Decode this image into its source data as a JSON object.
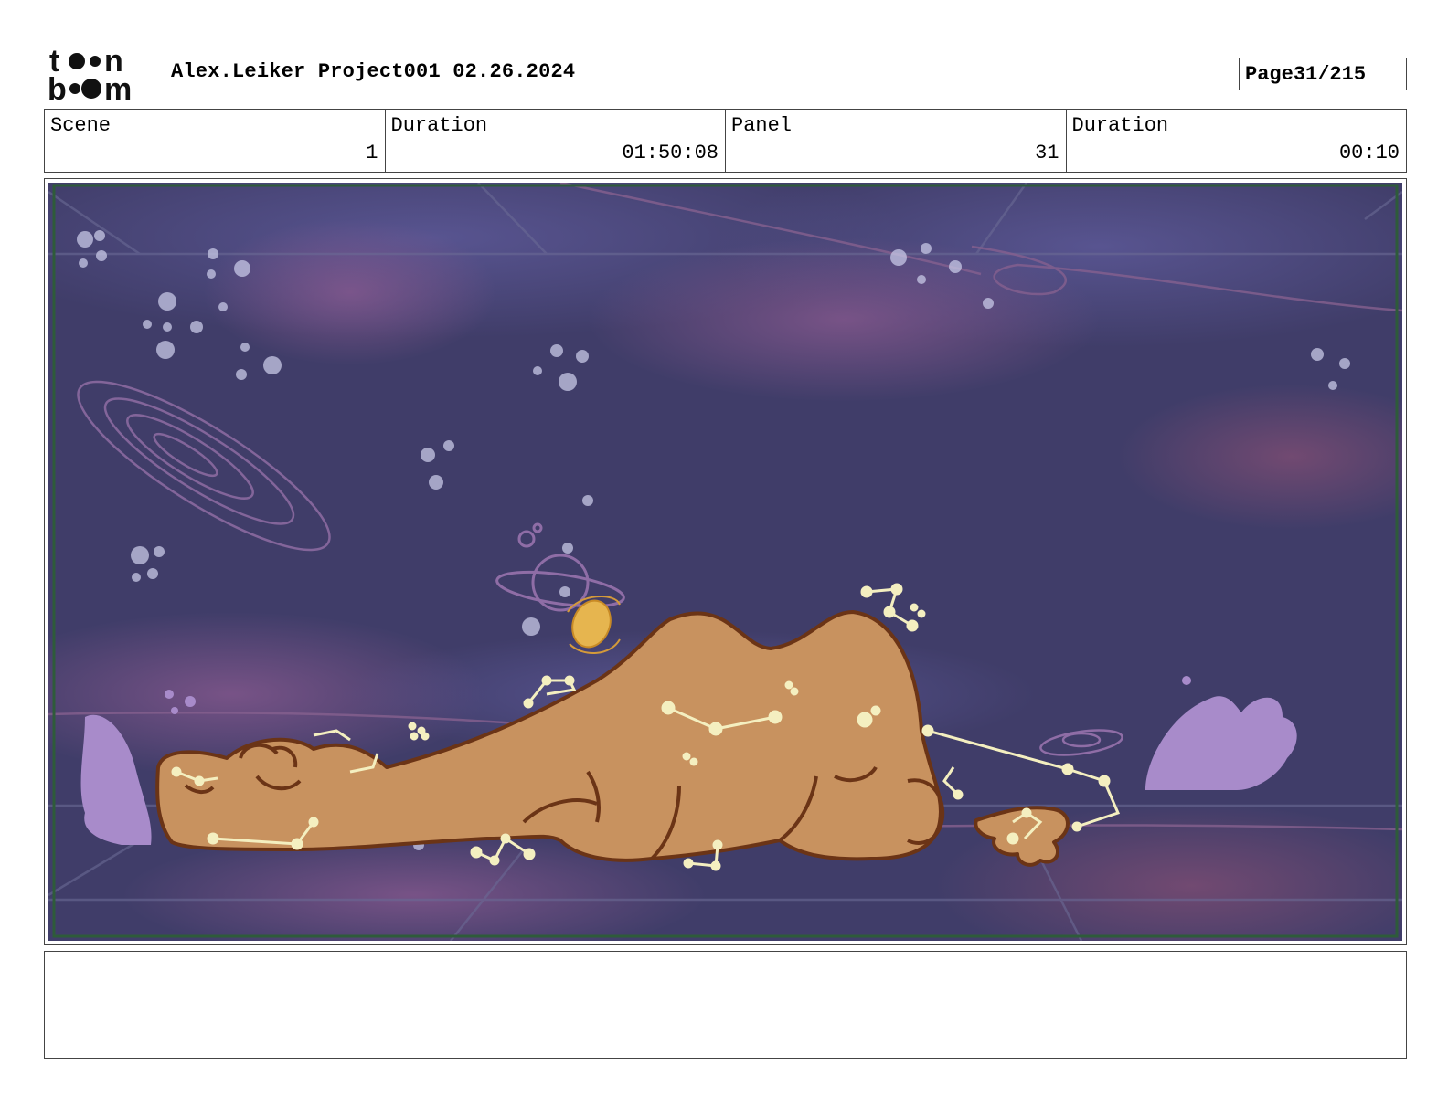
{
  "header": {
    "logo": {
      "top": "t●●n",
      "bottom": "b●●m"
    },
    "title": "Alex.Leiker Project001 02.26.2024",
    "page_label": "Page",
    "page_value": "31/215"
  },
  "info": {
    "scene_label": "Scene",
    "scene_value": "1",
    "scene_duration_label": "Duration",
    "scene_duration_value": "01:50:08",
    "panel_label": "Panel",
    "panel_value": "31",
    "panel_duration_label": "Duration",
    "panel_duration_value": "00:10"
  },
  "panel": {
    "icon": "storyboard-panel-illustration",
    "colors": {
      "sky": "#3f3c66",
      "nebula": "#7a4f86",
      "camel": "#c8925f",
      "outline": "#6b3416",
      "stars": "#f4efc0",
      "leaf": "#a88bc9",
      "planet": "#e6b54f",
      "frame": "#2e5b3a"
    }
  },
  "caption": {
    "text": ""
  }
}
